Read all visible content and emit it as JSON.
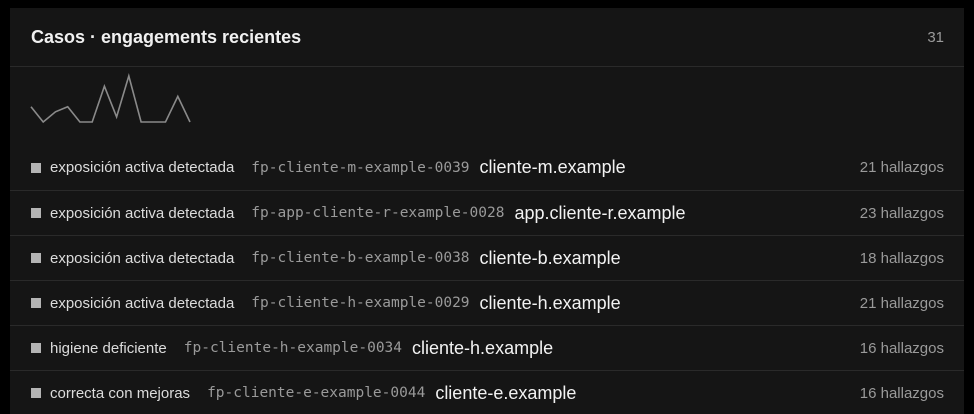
{
  "header": {
    "title": "Casos · engagements recientes",
    "count": "31"
  },
  "sparkline": {
    "values": [
      4,
      1,
      3,
      4,
      1,
      1,
      8,
      2,
      10,
      1,
      1,
      1,
      6,
      1
    ]
  },
  "rows": [
    {
      "status": "exposición activa detectada",
      "fingerprint": "fp-cliente-m-example-0039",
      "domain": "cliente-m.example",
      "findings": "21 hallazgos"
    },
    {
      "status": "exposición activa detectada",
      "fingerprint": "fp-app-cliente-r-example-0028",
      "domain": "app.cliente-r.example",
      "findings": "23 hallazgos"
    },
    {
      "status": "exposición activa detectada",
      "fingerprint": "fp-cliente-b-example-0038",
      "domain": "cliente-b.example",
      "findings": "18 hallazgos"
    },
    {
      "status": "exposición activa detectada",
      "fingerprint": "fp-cliente-h-example-0029",
      "domain": "cliente-h.example",
      "findings": "21 hallazgos"
    },
    {
      "status": "higiene deficiente",
      "fingerprint": "fp-cliente-h-example-0034",
      "domain": "cliente-h.example",
      "findings": "16 hallazgos"
    },
    {
      "status": "correcta con mejoras",
      "fingerprint": "fp-cliente-e-example-0044",
      "domain": "cliente-e.example",
      "findings": "16 hallazgos"
    }
  ]
}
